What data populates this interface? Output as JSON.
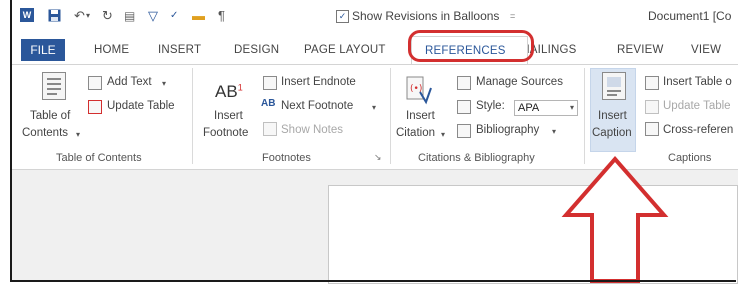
{
  "titlebar": {
    "word_logo": "W",
    "show_revisions_label": "Show Revisions in Balloons",
    "document_title": "Document1 [Co",
    "icons": [
      "save-icon",
      "undo-icon",
      "redo-icon",
      "spelling-icon",
      "filter-icon",
      "open-folder-icon",
      "pilcrow-icon"
    ]
  },
  "tabs": {
    "file": "FILE",
    "home": "HOME",
    "insert": "INSERT",
    "design": "DESIGN",
    "page_layout": "PAGE LAYOUT",
    "references": "REFERENCES",
    "mailings": "MAILINGS",
    "review": "REVIEW",
    "view": "VIEW",
    "active": "REFERENCES"
  },
  "ribbon": {
    "toc": {
      "table_of_contents_line1": "Table of",
      "table_of_contents_line2": "Contents",
      "add_text": "Add Text",
      "update_table": "Update Table",
      "group_label": "Table of Contents"
    },
    "footnotes": {
      "ab_glyph": "AB",
      "ab_superscript": "1",
      "insert_footnote_line1": "Insert",
      "insert_footnote_line2": "Footnote",
      "insert_endnote": "Insert Endnote",
      "next_footnote": "Next Footnote",
      "show_notes": "Show Notes",
      "group_label": "Footnotes"
    },
    "citations": {
      "insert_citation_line1": "Insert",
      "insert_citation_line2": "Citation",
      "manage_sources": "Manage Sources",
      "style_label": "Style:",
      "style_value": "APA",
      "bibliography": "Bibliography",
      "group_label": "Citations & Bibliography"
    },
    "captions": {
      "insert_caption_line1": "Insert",
      "insert_caption_line2": "Caption",
      "insert_table_of_figures": "Insert Table o",
      "update_table": "Update Table",
      "cross_reference": "Cross-referen",
      "group_label": "Captions"
    }
  },
  "annotation": {
    "highlight_color": "#d32f2f",
    "arrow_color": "#d32f2f"
  },
  "colors": {
    "word_blue": "#2b579a",
    "caption_highlight": "#d9e4f2"
  }
}
